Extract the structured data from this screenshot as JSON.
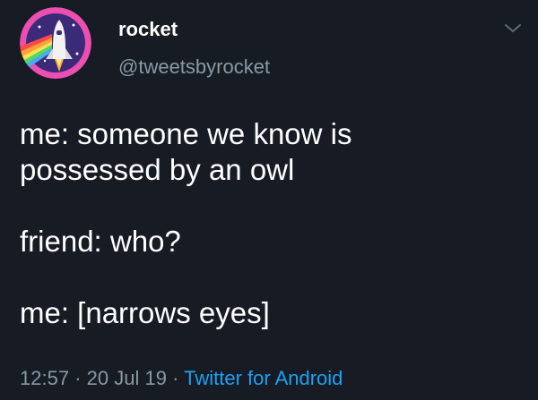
{
  "author": {
    "display_name": "rocket",
    "handle": "@tweetsbyrocket"
  },
  "icons": {
    "avatar": "rocket-shuttle-rainbow-avatar-icon",
    "menu": "chevron-down-icon"
  },
  "tweet": {
    "lines": [
      "me: someone we know is",
      "possessed by an owl",
      "friend: who?",
      "me: [narrows eyes]"
    ]
  },
  "meta": {
    "time": "12:57",
    "separator": "·",
    "date": "20 Jul 19",
    "source": "Twitter for Android"
  },
  "colors": {
    "background": "#161b24",
    "text": "#ffffff",
    "secondary_text": "#8899a6",
    "link": "#1da1f2"
  }
}
